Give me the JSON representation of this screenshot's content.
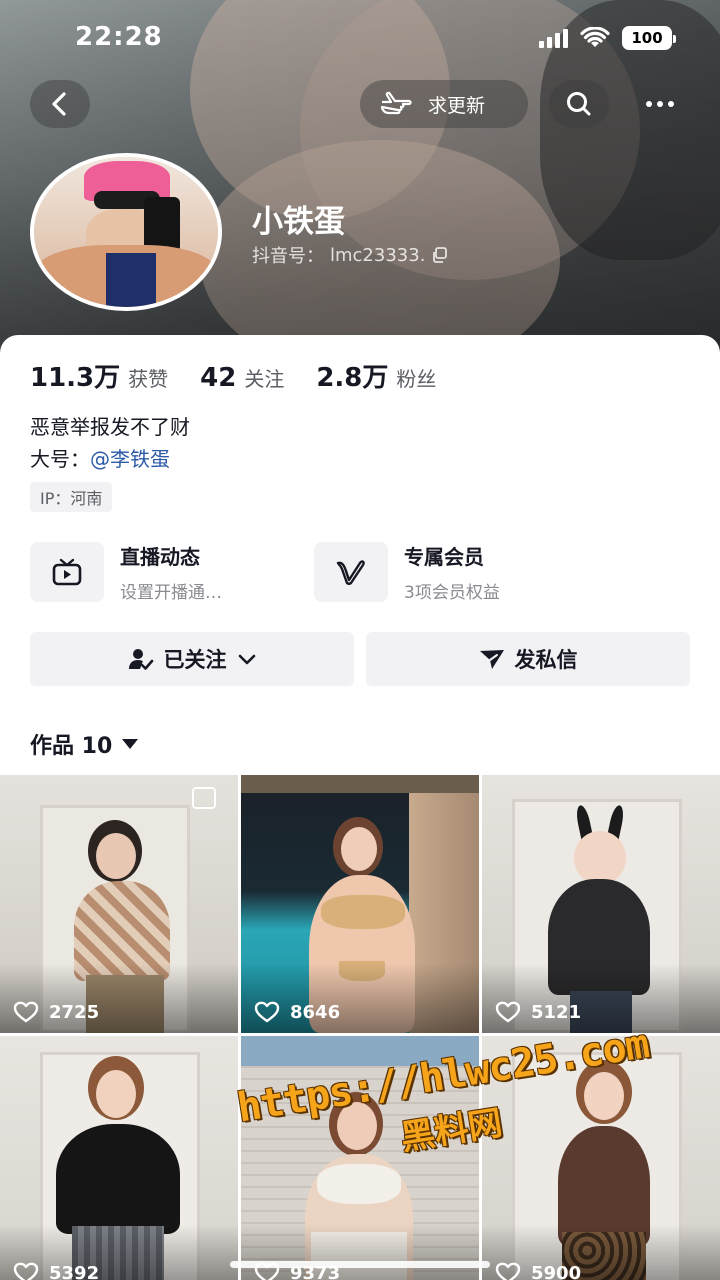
{
  "status_bar": {
    "time": "22:28",
    "battery": "100"
  },
  "header": {
    "request_update_label": "求更新"
  },
  "profile": {
    "nickname": "小铁蛋",
    "douyin_id_label": "抖音号：",
    "douyin_id": "lmc23333."
  },
  "stats": [
    {
      "value": "11.3万",
      "label": "获赞"
    },
    {
      "value": "42",
      "label": "关注"
    },
    {
      "value": "2.8万",
      "label": "粉丝"
    }
  ],
  "bio": "恶意举报发不了财",
  "alt_account": {
    "prefix": "大号：",
    "mention": "@李铁蛋"
  },
  "ip_tag": "IP：河南",
  "features": [
    {
      "title": "直播动态",
      "subtitle": "设置开播通…",
      "icon": "tv-icon"
    },
    {
      "title": "专属会员",
      "subtitle": "3项会员权益",
      "icon": "vip-v-icon"
    }
  ],
  "actions": {
    "following_label": "已关注",
    "message_label": "发私信"
  },
  "works": {
    "label": "作品 10"
  },
  "videos": [
    {
      "likes": "2725"
    },
    {
      "likes": "8646"
    },
    {
      "likes": "5121"
    },
    {
      "likes": "5392"
    },
    {
      "likes": "9373"
    },
    {
      "likes": "5900"
    }
  ],
  "watermark": {
    "url": "https://hlwc25.com",
    "name": "黑料网"
  },
  "colors": {
    "accent_link": "#2b5aa8",
    "watermark": "#f6a51b",
    "chip_bg": "#f2f2f4"
  }
}
